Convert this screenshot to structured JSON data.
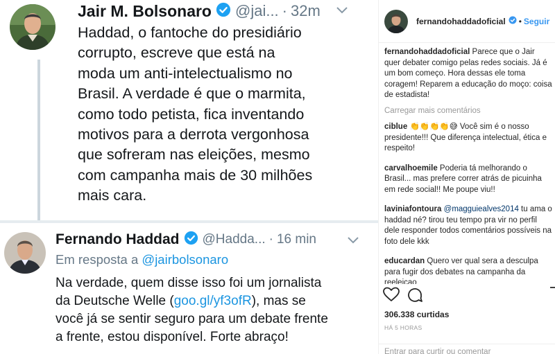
{
  "tweet_image": {
    "tweet1": {
      "name": "Jair M. Bolsonaro",
      "handle": "@jai...",
      "dot": "·",
      "time": "32m",
      "text": "Haddad, o fantoche do presidiário\ncorrupto, escreve que está na\nmoda um anti-intelectualismo no\nBrasil. A verdade é que o marmita,\ncomo todo petista, fica inventando\nmotivos para a derrota vergonhosa\nque sofreram nas eleições, mesmo\ncom campanha mais de 30 milhões\nmais cara."
    },
    "tweet2": {
      "name": "Fernando Haddad",
      "handle": "@Hadda...",
      "dot": "·",
      "time": "16 min",
      "reply_prefix": "Em resposta a",
      "reply_to": "@jairbolsonaro",
      "text_before_link": "Na verdade, quem disse isso foi um jornalista\nda Deutsche Welle (",
      "link": "goo.gl/yf3ofR",
      "text_after_link": "), mas se\nvocê já se sentir seguro para um debate frente\na frente, estou disponível. Forte abraço!"
    }
  },
  "instagram": {
    "header": {
      "username": "fernandohaddadoficial",
      "separator": "•",
      "follow_label": "Seguir"
    },
    "caption": {
      "user": "fernandohaddadoficial",
      "text": "Parece que o Jair quer debater comigo pelas redes sociais. Já é um bom começo. Hora dessas ele toma coragem! Reparem a educação do moço: coisa de estadista!"
    },
    "load_more": "Carregar mais comentários",
    "comments": [
      {
        "user": "ciblue",
        "emoji": "👏👏👏👏😅",
        "text": " Você sim é o nosso presidente!!! Que diferença intelectual, ética e respeito!"
      },
      {
        "user": "carvalhoemile",
        "text": "Poderia tá melhorando o Brasil... mas prefere correr atrás de picuinha em rede social!! Me poupe viu!!"
      },
      {
        "user": "laviniafontoura",
        "mention": "@magguiealves2014",
        "text": " tu ama o haddad né? tirou teu tempo pra vir no perfil dele responder todos comentários possíveis na foto dele kkk"
      },
      {
        "user": "educardan",
        "text": "Quero ver qual sera a desculpa para fugir dos debates na campanha da reeleicao"
      }
    ],
    "likes": "306.338 curtidas",
    "time_ago": "HÁ 5 HORAS",
    "add_comment_placeholder": "Entrar para curtir ou comentar",
    "colors": {
      "link": "#3897f0",
      "twitter_link": "#1b95e0",
      "verified": "#1da1f2"
    },
    "icons": [
      "heart-icon",
      "comment-icon",
      "bookmark-icon",
      "verified-icon",
      "chevron-down-icon"
    ]
  }
}
